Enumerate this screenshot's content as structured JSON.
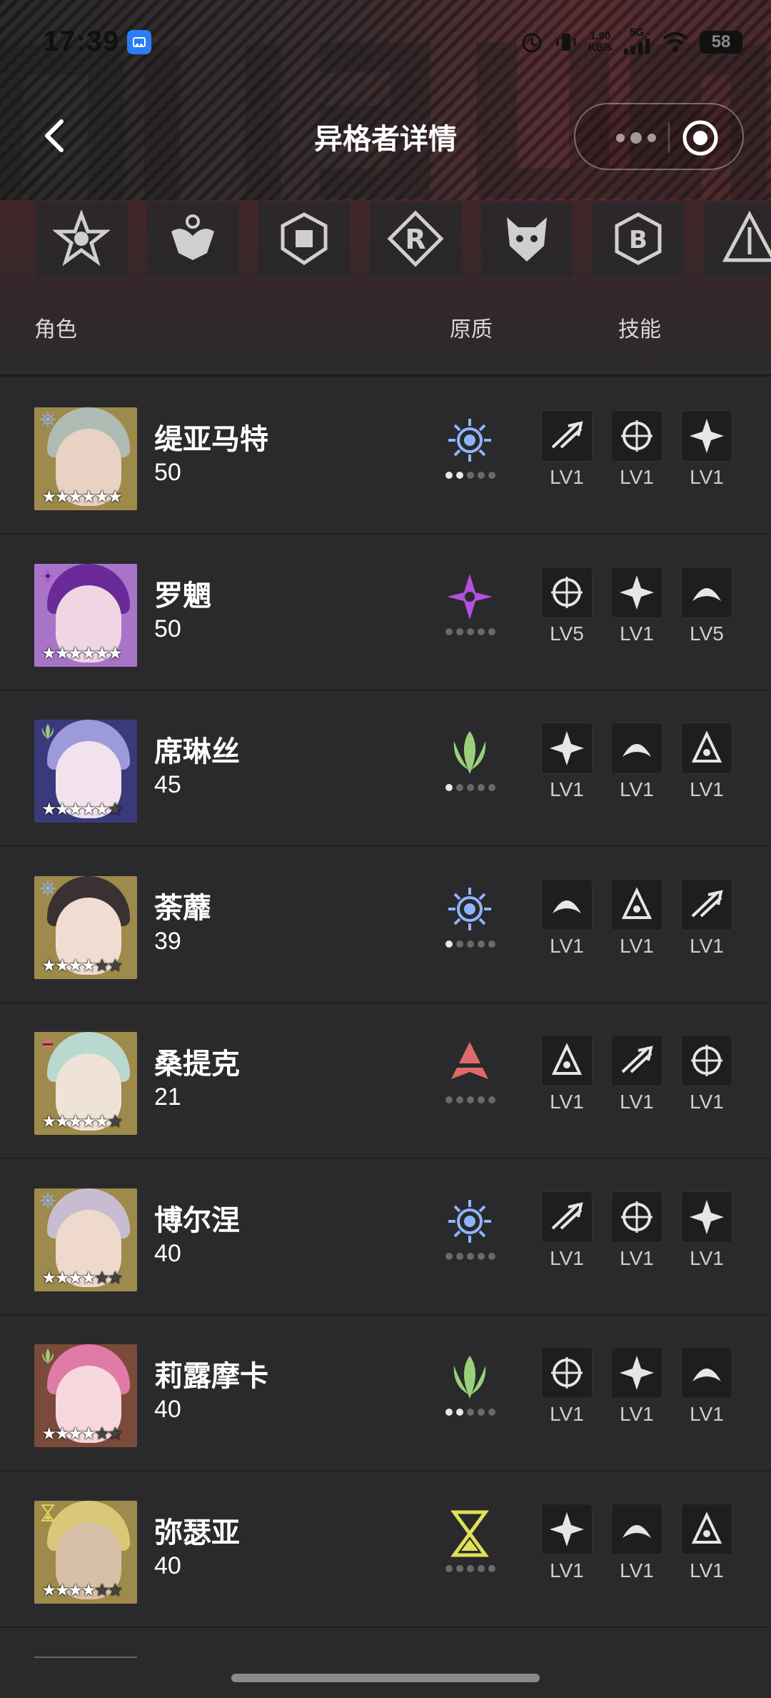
{
  "status_bar": {
    "time": "17:39",
    "net_speed": "1.90",
    "net_unit": "KB/s",
    "network": "5G",
    "battery": "58"
  },
  "header": {
    "title": "异格者详情",
    "back_icon": "chevron-left-icon",
    "more_icon": "more-dots-icon",
    "record_icon": "target-circle-icon"
  },
  "filters": [
    {
      "icon": "faction-star-emblem-icon"
    },
    {
      "icon": "faction-winged-crown-icon"
    },
    {
      "icon": "faction-shield-gear-icon"
    },
    {
      "icon": "faction-r-diamond-icon"
    },
    {
      "icon": "faction-beast-head-icon"
    },
    {
      "icon": "faction-hex-b-icon"
    },
    {
      "icon": "faction-triangle-icon"
    }
  ],
  "columns": {
    "role": "角色",
    "attribute": "原质",
    "skill": "技能"
  },
  "characters": [
    {
      "name": "缇亚马特",
      "level": "50",
      "attribute": "eye-sun",
      "attr_color": "#8fb4ff",
      "dots": 2,
      "stars": 6,
      "skills": [
        "LV1",
        "LV1",
        "LV1"
      ],
      "skin": "#e7d2c4",
      "hair": "#aebcb4",
      "bg": "#9e8a4a"
    },
    {
      "name": "罗魍",
      "level": "50",
      "attribute": "shuriken",
      "attr_color": "#b44fe0",
      "dots": 0,
      "stars": 6,
      "skills": [
        "LV5",
        "LV1",
        "LV5"
      ],
      "skin": "#f0d6e2",
      "hair": "#6a2a9a",
      "bg": "#a874c8"
    },
    {
      "name": "席琳丝",
      "level": "45",
      "attribute": "leaf-flame",
      "attr_color": "#9ad07a",
      "dots": 1,
      "stars": 5,
      "skills": [
        "LV1",
        "LV1",
        "LV1"
      ],
      "skin": "#f2e2ee",
      "hair": "#9c9ad8",
      "bg": "#3a3a7a"
    },
    {
      "name": "荼蘼",
      "level": "39",
      "attribute": "eye-sun",
      "attr_color": "#8fb4ff",
      "dots": 1,
      "stars": 4,
      "skills": [
        "LV1",
        "LV1",
        "LV1"
      ],
      "skin": "#f0ddd2",
      "hair": "#3a3232",
      "bg": "#9e8a4a"
    },
    {
      "name": "桑提克",
      "level": "21",
      "attribute": "tri-spike",
      "attr_color": "#e06a6a",
      "dots": 0,
      "stars": 5,
      "skills": [
        "LV1",
        "LV1",
        "LV1"
      ],
      "skin": "#efe2d6",
      "hair": "#b8d8d0",
      "bg": "#9e8a4a"
    },
    {
      "name": "博尔涅",
      "level": "40",
      "attribute": "eye-sun",
      "attr_color": "#8fb4ff",
      "dots": 0,
      "stars": 4,
      "skills": [
        "LV1",
        "LV1",
        "LV1"
      ],
      "skin": "#eed9cc",
      "hair": "#c8bcd0",
      "bg": "#9e8a4a"
    },
    {
      "name": "莉露摩卡",
      "level": "40",
      "attribute": "leaf-flame",
      "attr_color": "#9ad07a",
      "dots": 2,
      "stars": 4,
      "skills": [
        "LV1",
        "LV1",
        "LV1"
      ],
      "skin": "#f6d8de",
      "hair": "#e07aa8",
      "bg": "#7a4a3a"
    },
    {
      "name": "弥瑟亚",
      "level": "40",
      "attribute": "hourglass",
      "attr_color": "#e0e05a",
      "dots": 0,
      "stars": 4,
      "skills": [
        "LV1",
        "LV1",
        "LV1"
      ],
      "skin": "#d8c0a8",
      "hair": "#d8c878",
      "bg": "#9e8a4a"
    }
  ]
}
